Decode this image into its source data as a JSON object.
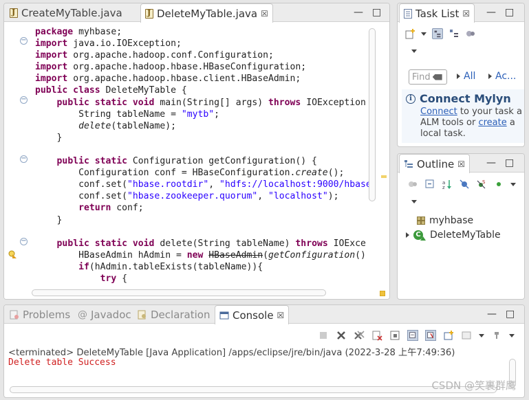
{
  "editor": {
    "tabs": [
      {
        "label": "CreateMyTable.java"
      },
      {
        "label": "DeleteMyTable.java",
        "close": "☒"
      }
    ],
    "code_lines": [
      [
        {
          "t": "package",
          "c": "kw"
        },
        {
          "t": " myhbase;"
        }
      ],
      [
        {
          "t": "import",
          "c": "kw"
        },
        {
          "t": " java.io.IOException;"
        }
      ],
      [
        {
          "t": "import",
          "c": "kw"
        },
        {
          "t": " org.apache.hadoop.conf.Configuration;"
        }
      ],
      [
        {
          "t": "import",
          "c": "kw"
        },
        {
          "t": " org.apache.hadoop.hbase.HBaseConfiguration;"
        }
      ],
      [
        {
          "t": "import",
          "c": "kw"
        },
        {
          "t": " org.apache.hadoop.hbase.client.HBaseAdmin;"
        }
      ],
      [
        {
          "t": "public class",
          "c": "kw"
        },
        {
          "t": " DeleteMyTable {"
        }
      ],
      [
        {
          "t": "    "
        },
        {
          "t": "public static void",
          "c": "kw"
        },
        {
          "t": " main(String[] args) "
        },
        {
          "t": "throws",
          "c": "kw"
        },
        {
          "t": " IOException"
        }
      ],
      [
        {
          "t": "        String tableName = "
        },
        {
          "t": "\"mytb\"",
          "c": "str"
        },
        {
          "t": ";"
        }
      ],
      [
        {
          "t": "        "
        },
        {
          "t": "delete",
          "c": "it"
        },
        {
          "t": "(tableName);"
        }
      ],
      [
        {
          "t": "    }"
        }
      ],
      [
        {
          "t": ""
        }
      ],
      [
        {
          "t": "    "
        },
        {
          "t": "public static",
          "c": "kw"
        },
        {
          "t": " Configuration getConfiguration() {"
        }
      ],
      [
        {
          "t": "        Configuration conf = HBaseConfiguration."
        },
        {
          "t": "create",
          "c": "it"
        },
        {
          "t": "();"
        }
      ],
      [
        {
          "t": "        conf.set("
        },
        {
          "t": "\"hbase.rootdir\"",
          "c": "str"
        },
        {
          "t": ", "
        },
        {
          "t": "\"hdfs://localhost:9000/hbase\"",
          "c": "str"
        }
      ],
      [
        {
          "t": "        conf.set("
        },
        {
          "t": "\"hbase.zookeeper.quorum\"",
          "c": "str"
        },
        {
          "t": ", "
        },
        {
          "t": "\"localhost\"",
          "c": "str"
        },
        {
          "t": ");"
        }
      ],
      [
        {
          "t": "        "
        },
        {
          "t": "return",
          "c": "kw"
        },
        {
          "t": " conf;"
        }
      ],
      [
        {
          "t": "    }"
        }
      ],
      [
        {
          "t": ""
        }
      ],
      [
        {
          "t": "    "
        },
        {
          "t": "public static void",
          "c": "kw"
        },
        {
          "t": " delete(String tableName) "
        },
        {
          "t": "throws",
          "c": "kw"
        },
        {
          "t": " IOExce"
        }
      ],
      [
        {
          "t": "        HBaseAdmin hAdmin = "
        },
        {
          "t": "new",
          "c": "kw"
        },
        {
          "t": " "
        },
        {
          "t": "HBaseAdmin",
          "c": "strike"
        },
        {
          "t": "("
        },
        {
          "t": "getConfiguration",
          "c": "it"
        },
        {
          "t": "()"
        }
      ],
      [
        {
          "t": "        "
        },
        {
          "t": "if",
          "c": "kw"
        },
        {
          "t": "(hAdmin.tableExists(tableName)){"
        }
      ],
      [
        {
          "t": "            "
        },
        {
          "t": "try",
          "c": "kw"
        },
        {
          "t": " {"
        }
      ]
    ]
  },
  "tasklist": {
    "title": "Task List",
    "close": "☒",
    "find_placeholder": "Find",
    "link_all": "All",
    "link_ac": "Ac...",
    "mylyn_title": "Connect Mylyn",
    "mylyn_connect": "Connect",
    "mylyn_line1_rest": " to your task a",
    "mylyn_line2_pre": "ALM tools or ",
    "mylyn_create": "create",
    "mylyn_line2_rest": " a",
    "mylyn_line3": "local task."
  },
  "outline": {
    "title": "Outline",
    "close": "☒",
    "items": [
      {
        "label": "myhbase"
      },
      {
        "label": "DeleteMyTable"
      }
    ]
  },
  "console": {
    "tabs": [
      {
        "label": "Problems"
      },
      {
        "label": "Javadoc"
      },
      {
        "label": "Declaration"
      },
      {
        "label": "Console",
        "close": "☒"
      }
    ],
    "status": "<terminated> DeleteMyTable [Java Application] /apps/eclipse/jre/bin/java (2022-3-28 上午7:49:36)",
    "output": "Delete table Success"
  },
  "window": {
    "minimize": "—",
    "maximize": "□"
  },
  "watermark": "CSDN @笑裹群鹰",
  "colors": {
    "keyword": "#7f0055",
    "string": "#2a00ff",
    "error_output": "#d02020",
    "link": "#2b5fb8"
  }
}
